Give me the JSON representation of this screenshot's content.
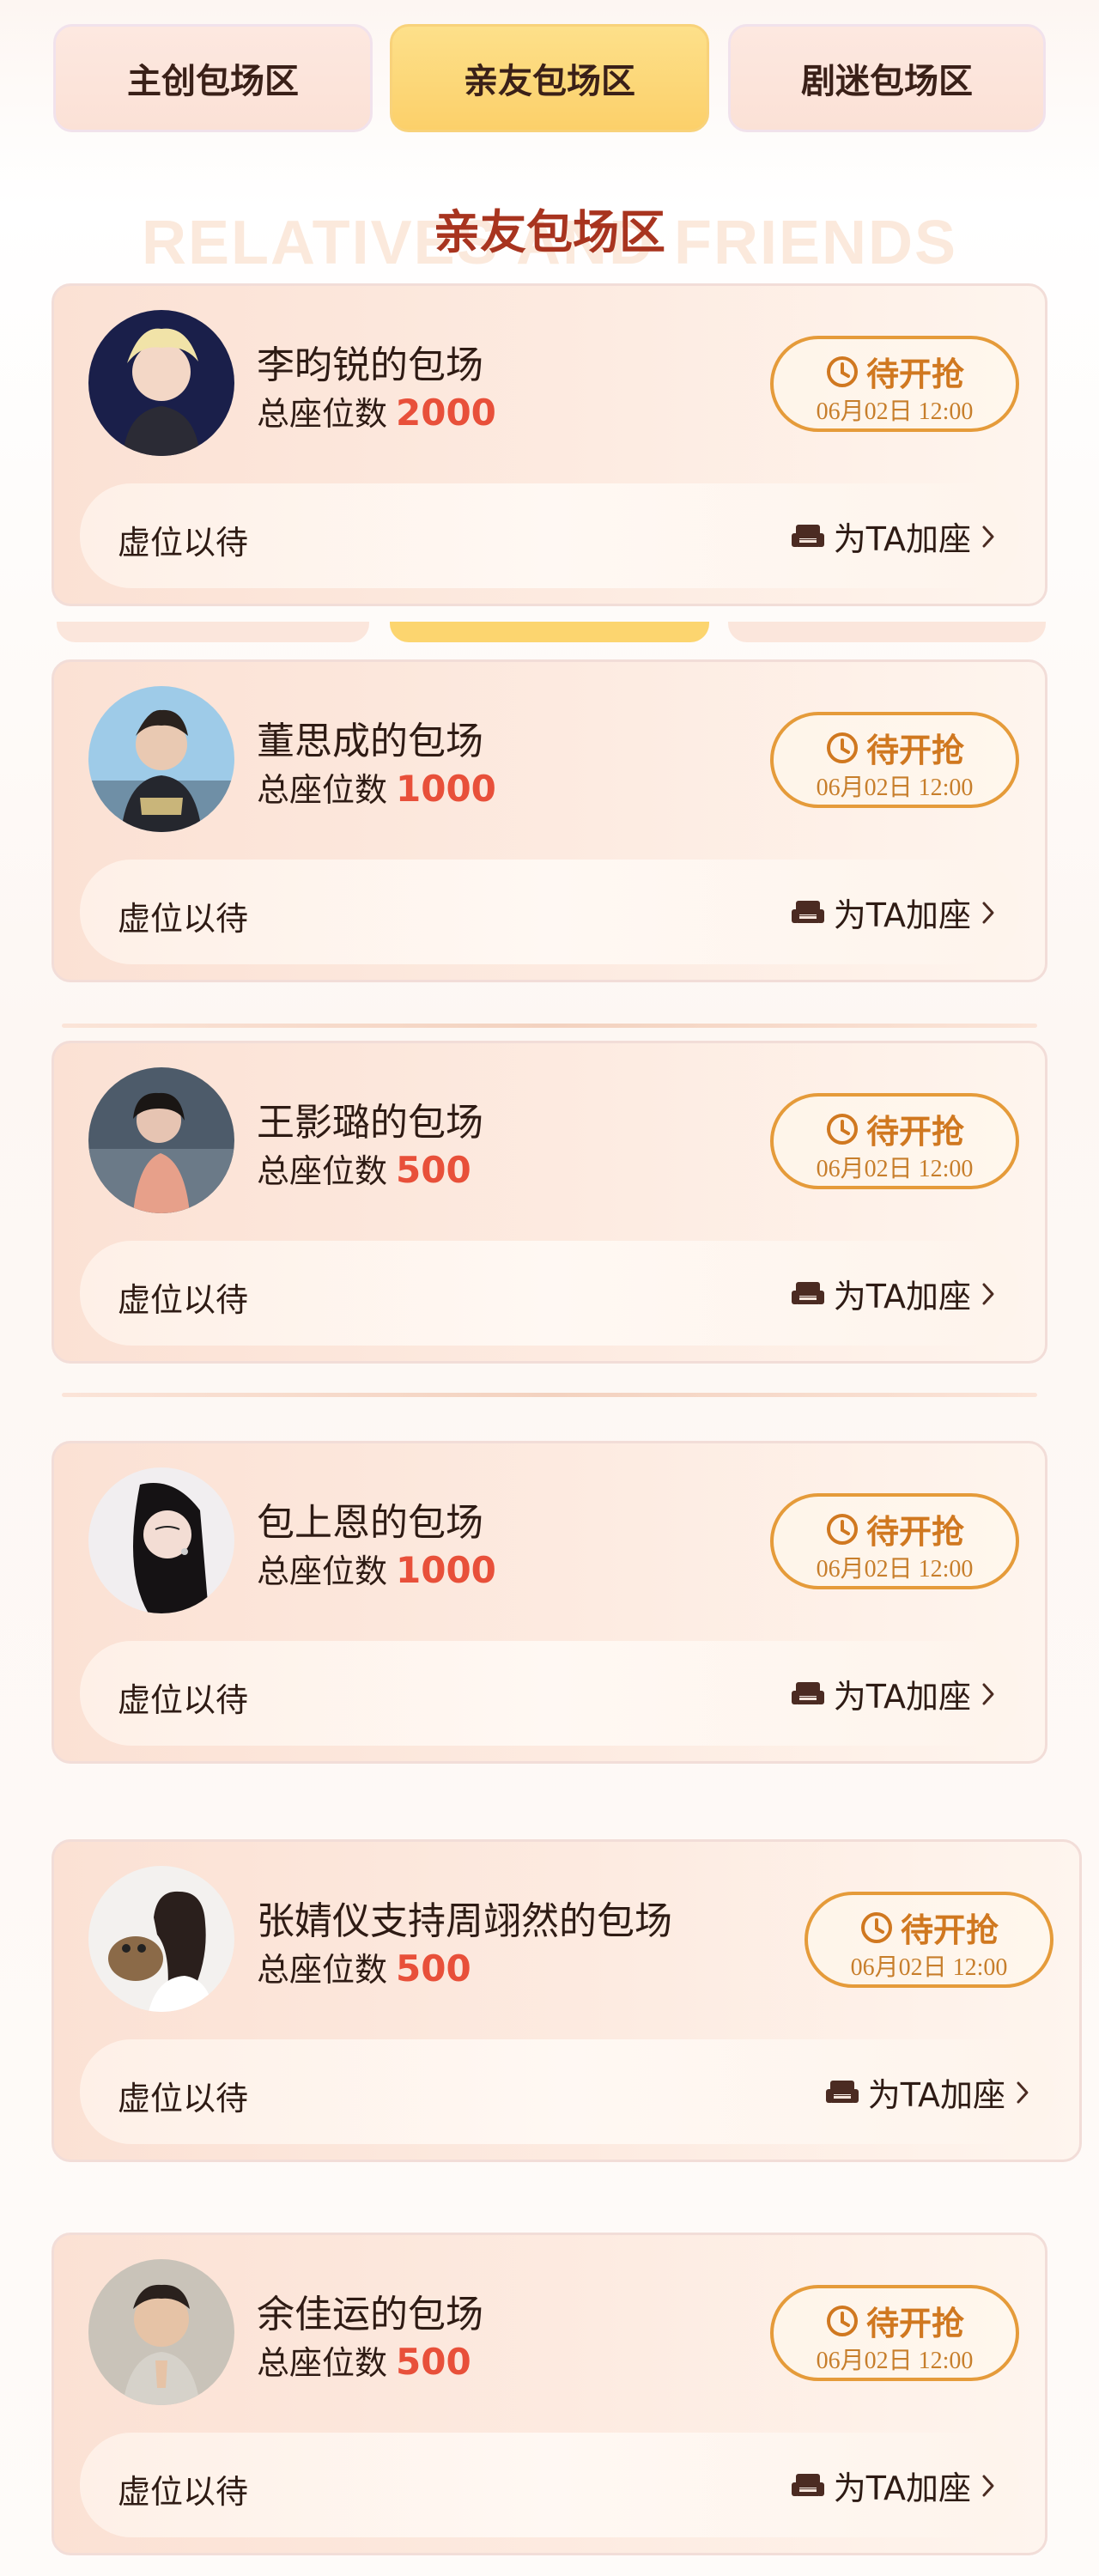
{
  "tabs": [
    {
      "label": "主创包场区",
      "active": false
    },
    {
      "label": "亲友包场区",
      "active": true
    },
    {
      "label": "剧迷包场区",
      "active": false
    }
  ],
  "section": {
    "title": "亲友包场区",
    "watermark": "RELATIVES AND FRIENDS"
  },
  "cards": [
    {
      "name": "李昀锐的包场",
      "seats_label": "总座位数",
      "seats": "2000",
      "status": "待开抢",
      "time": "06月02日 12:00",
      "waiting": "虚位以待",
      "action": "为TA加座",
      "avatar": "avatar-blond-man"
    },
    {
      "name": "董思成的包场",
      "seats_label": "总座位数",
      "seats": "1000",
      "status": "待开抢",
      "time": "06月02日 12:00",
      "waiting": "虚位以待",
      "action": "为TA加座",
      "avatar": "avatar-man-sky"
    },
    {
      "name": "王影璐的包场",
      "seats_label": "总座位数",
      "seats": "500",
      "status": "待开抢",
      "time": "06月02日 12:00",
      "waiting": "虚位以待",
      "action": "为TA加座",
      "avatar": "avatar-woman-sea"
    },
    {
      "name": "包上恩的包场",
      "seats_label": "总座位数",
      "seats": "1000",
      "status": "待开抢",
      "time": "06月02日 12:00",
      "waiting": "虚位以待",
      "action": "为TA加座",
      "avatar": "avatar-woman-white"
    },
    {
      "name": "张婧仪支持周翊然的包场",
      "seats_label": "总座位数",
      "seats": "500",
      "status": "待开抢",
      "time": "06月02日 12:00",
      "waiting": "虚位以待",
      "action": "为TA加座",
      "avatar": "avatar-woman-dog"
    },
    {
      "name": "余佳运的包场",
      "seats_label": "总座位数",
      "seats": "500",
      "status": "待开抢",
      "time": "06月02日 12:00",
      "waiting": "虚位以待",
      "action": "为TA加座",
      "avatar": "avatar-child"
    }
  ],
  "colors": {
    "accent_red": "#e8503a",
    "title_red": "#a8341f",
    "status_orange": "#d07820",
    "active_tab": "#fcd06a"
  }
}
